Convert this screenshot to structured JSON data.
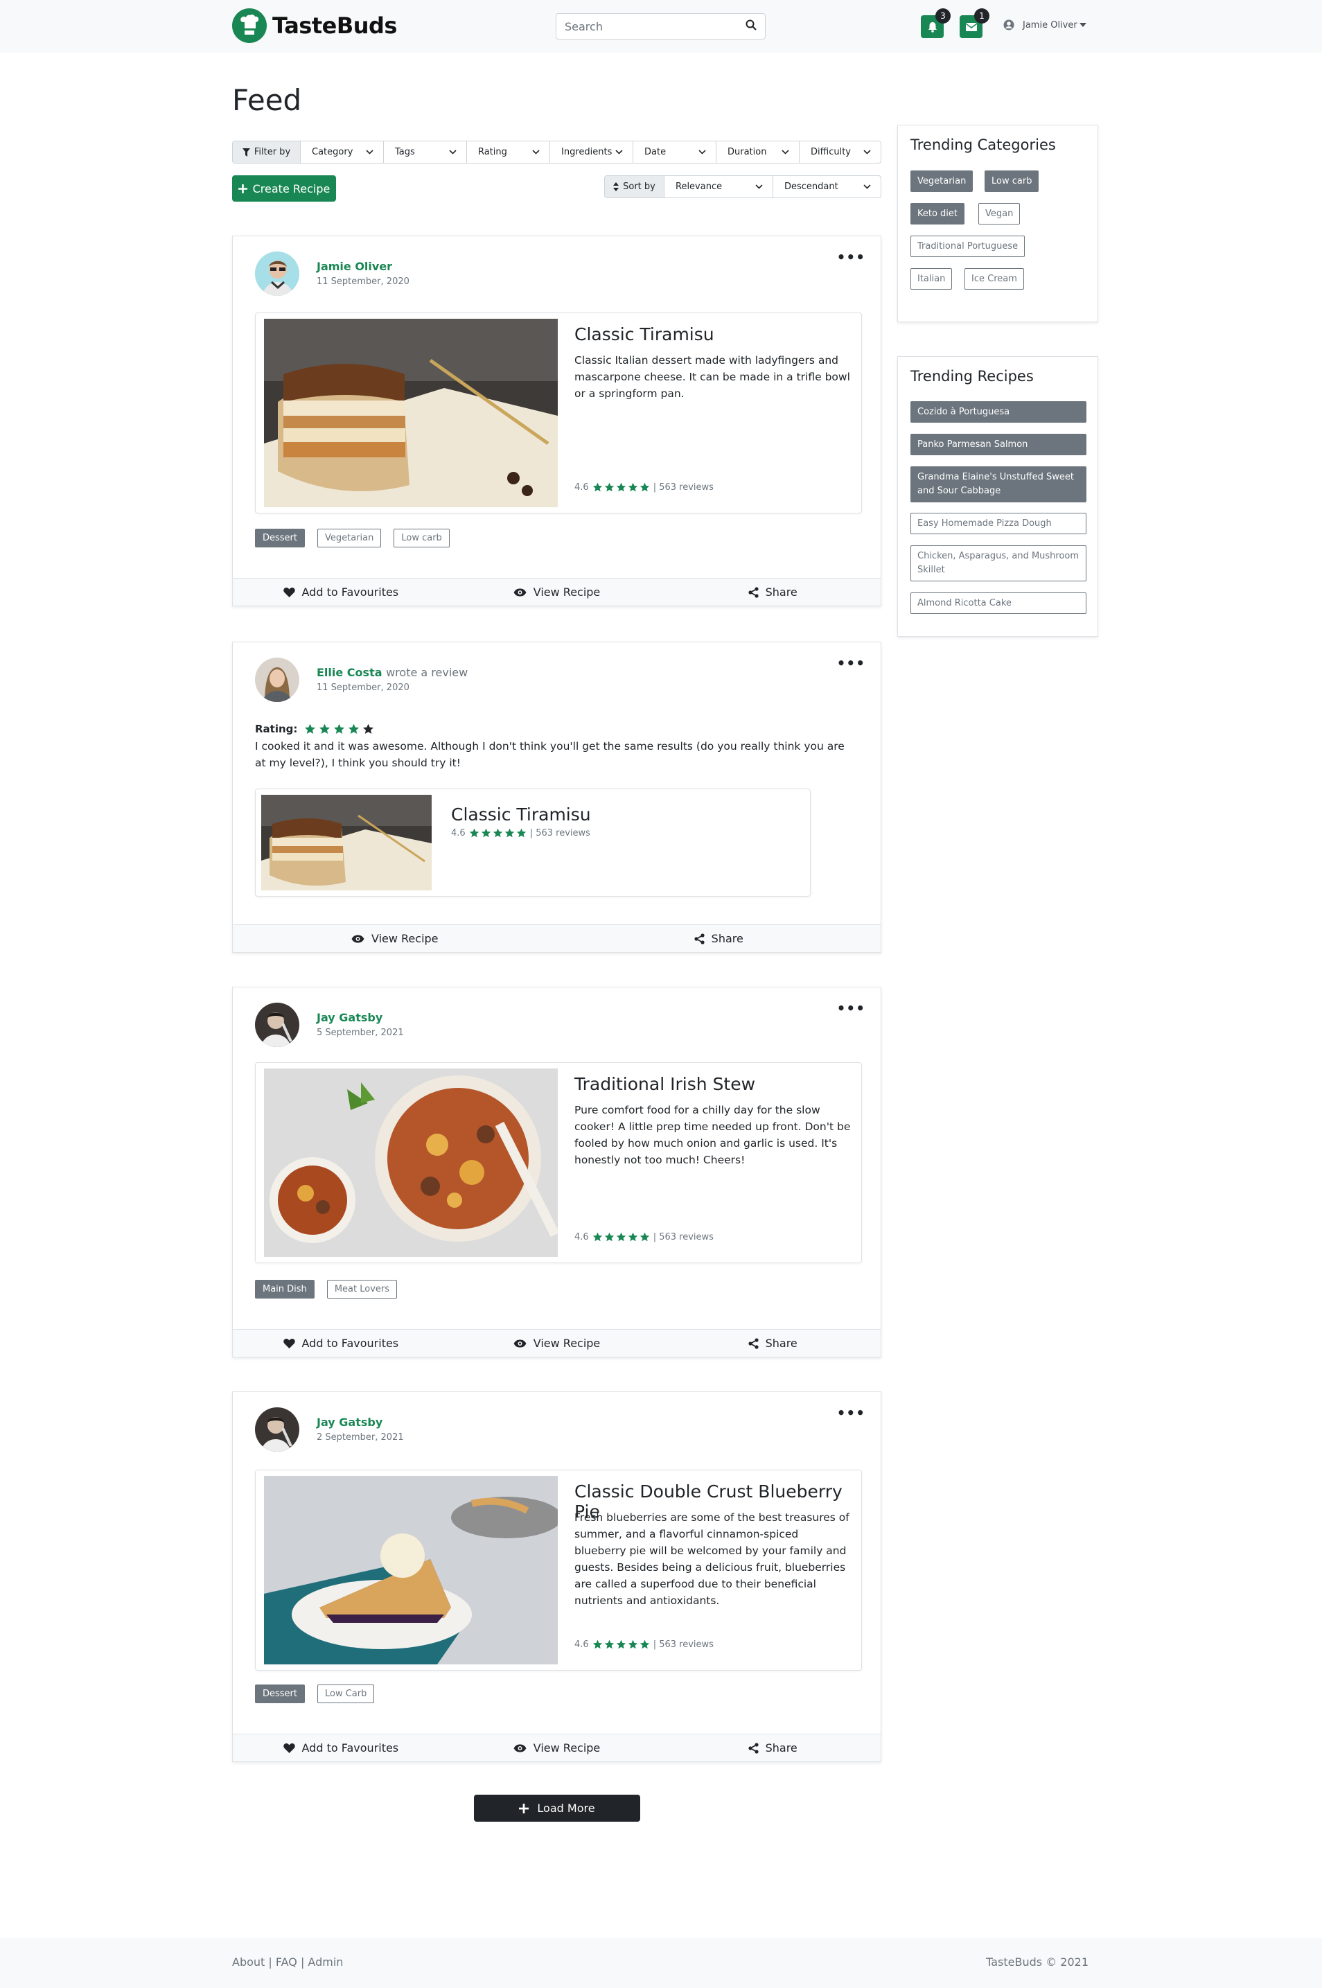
{
  "header": {
    "brand": "TasteBuds",
    "search_placeholder": "Search",
    "notifications_count": "3",
    "messages_count": "1",
    "user_name": "Jamie Oliver"
  },
  "page_title": "Feed",
  "filters": {
    "filter_label": "Filter by",
    "selects": [
      "Category",
      "Tags",
      "Rating",
      "Ingredients",
      "Date",
      "Duration",
      "Difficulty"
    ],
    "create_label": "Create Recipe",
    "sort_label": "Sort by",
    "sort_value": "Relevance",
    "order_value": "Descendant"
  },
  "posts": [
    {
      "author": "Jamie Oliver",
      "date": "11 September, 2020",
      "recipe_title": "Classic Tiramisu",
      "description": "Classic Italian dessert made with ladyfingers and mascarpone cheese. It can be made in a trifle bowl or a springform pan.",
      "rating": "4.6",
      "reviews": "| 563 reviews",
      "tags": [
        "Dessert",
        "Vegetarian",
        "Low carb"
      ]
    },
    {
      "author": "Ellie Costa",
      "wrote": "wrote a review",
      "date": "11 September, 2020",
      "rating_label": "Rating:",
      "review_text": "I cooked it and it was awesome. Although I don't think you'll get the same results (do you really think you are at my level?), I think you should try it!",
      "recipe_title": "Classic Tiramisu",
      "rating": "4.6",
      "reviews": "| 563 reviews"
    },
    {
      "author": "Jay Gatsby",
      "date": "5 September, 2021",
      "recipe_title": "Traditional Irish Stew",
      "description": "Pure comfort food for a chilly day for the slow cooker! A little prep time needed up front. Don't be fooled by how much onion and garlic is used. It's honestly not too much! Cheers!",
      "rating": "4.6",
      "reviews": "| 563 reviews",
      "tags": [
        "Main Dish",
        "Meat Lovers"
      ]
    },
    {
      "author": "Jay Gatsby",
      "date": "2 September, 2021",
      "recipe_title": "Classic Double Crust Blueberry Pie",
      "description": "Fresh blueberries are some of the best treasures of summer, and a flavorful cinnamon-spiced blueberry pie will be welcomed by your family and guests. Besides being a delicious fruit, blueberries are called a superfood due to their beneficial nutrients and antioxidants.",
      "rating": "4.6",
      "reviews": "| 563 reviews",
      "tags": [
        "Dessert",
        "Low Carb"
      ]
    }
  ],
  "actions": {
    "favourite": "Add to Favourites",
    "view": "View Recipe",
    "share": "Share"
  },
  "trending_categories": {
    "title": "Trending Categories",
    "items": [
      "Vegetarian",
      "Low carb",
      "Keto diet",
      "Vegan",
      "Traditional Portuguese",
      "Italian",
      "Ice Cream"
    ]
  },
  "trending_recipes": {
    "title": "Trending Recipes",
    "items": [
      "Cozido à Portuguesa",
      "Panko Parmesan Salmon",
      "Grandma Elaine's Unstuffed Sweet and Sour Cabbage",
      "Easy Homemade Pizza Dough",
      "Chicken, Asparagus, and Mushroom Skillet",
      "Almond Ricotta Cake"
    ]
  },
  "load_more": "Load More",
  "footer": {
    "links": "About | FAQ | Admin",
    "copyright": "TasteBuds © 2021"
  },
  "colors": {
    "brand_green": "#198754",
    "dark": "#212529",
    "tag_gray": "#6c757d"
  }
}
